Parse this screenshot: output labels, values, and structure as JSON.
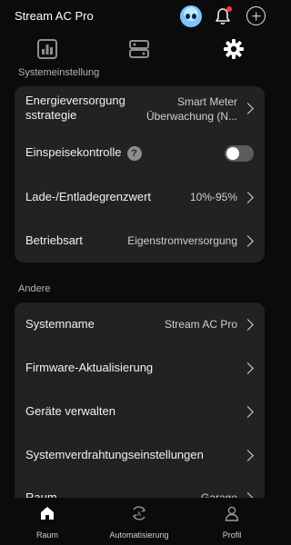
{
  "header": {
    "title": "Stream AC Pro"
  },
  "sections": {
    "system_settings": {
      "title": "Systemeinstellung",
      "rows": [
        {
          "label": "Energieversorgung sstrategie",
          "label_line1": "Energieversorgung",
          "label_line2": "sstrategie",
          "value_line1": "Smart Meter",
          "value_line2": "Überwachung (N..."
        },
        {
          "label": "Einspeisekontrolle",
          "help": "?",
          "toggle": "off"
        },
        {
          "label": "Lade-/Entladegrenzwert",
          "value": "10%-95%"
        },
        {
          "label": "Betriebsart",
          "value": "Eigenstromversorgung"
        }
      ]
    },
    "other": {
      "title": "Andere",
      "rows": [
        {
          "label": "Systemname",
          "value": "Stream AC Pro"
        },
        {
          "label": "Firmware-Aktualisierung"
        },
        {
          "label": "Geräte verwalten"
        },
        {
          "label": "Systemverdrahtungseinstellungen"
        },
        {
          "label": "Raum",
          "value": "Garage"
        }
      ]
    }
  },
  "bottom_nav": {
    "items": [
      {
        "label": "Raum",
        "icon": "home-icon"
      },
      {
        "label": "Automatisierung",
        "icon": "automation-icon"
      },
      {
        "label": "Profil",
        "icon": "profile-icon"
      }
    ]
  },
  "colors": {
    "background": "#0b0b0c",
    "card": "#222224",
    "notification": "#ff3b30"
  }
}
